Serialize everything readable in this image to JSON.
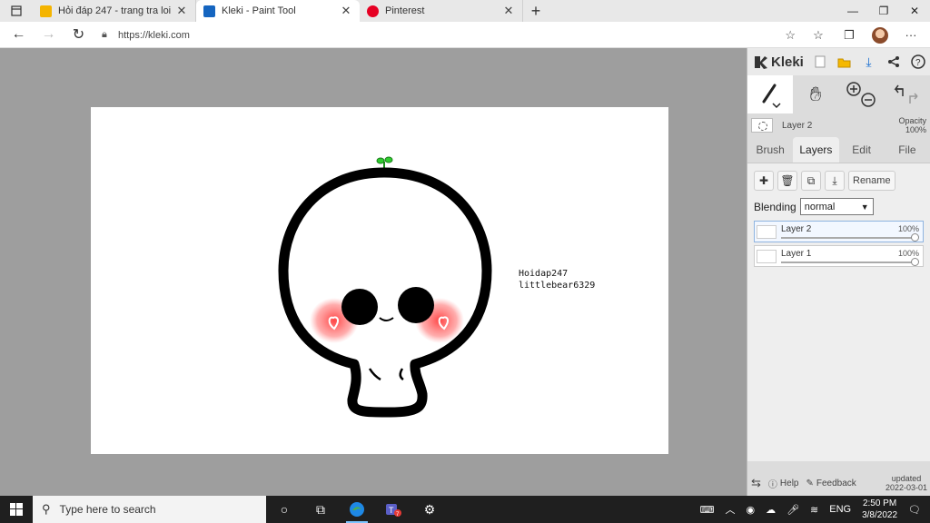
{
  "browser": {
    "tabs": [
      {
        "title": "Hỏi đáp 247 - trang tra loi",
        "favicon_color": "#f4b400"
      },
      {
        "title": "Kleki - Paint Tool",
        "favicon_color": "#1565c0",
        "active": true
      },
      {
        "title": "Pinterest",
        "favicon_color": "#e60023"
      }
    ],
    "new_tab": "+",
    "url": "https://kleki.com"
  },
  "canvas": {
    "watermark_line1": "Hoidap247",
    "watermark_line2": "littlebear6329"
  },
  "kleki": {
    "logo": "Kleki",
    "layer_name": "Layer 2",
    "opacity_label": "Opacity",
    "opacity_value": "100%",
    "tabs": [
      "Brush",
      "Layers",
      "Edit",
      "File"
    ],
    "rename_label": "Rename",
    "blending_label": "Blending",
    "blending_value": "normal",
    "layers": [
      {
        "name": "Layer 2",
        "opacity": "100%"
      },
      {
        "name": "Layer 1",
        "opacity": "100%"
      }
    ],
    "footer": {
      "help": "Help",
      "feedback": "Feedback",
      "updated_label": "updated",
      "updated_date": "2022-03-01"
    }
  },
  "taskbar": {
    "search_placeholder": "Type here to search",
    "badge": "7",
    "language": "ENG",
    "time": "2:50 PM",
    "date": "3/8/2022"
  }
}
